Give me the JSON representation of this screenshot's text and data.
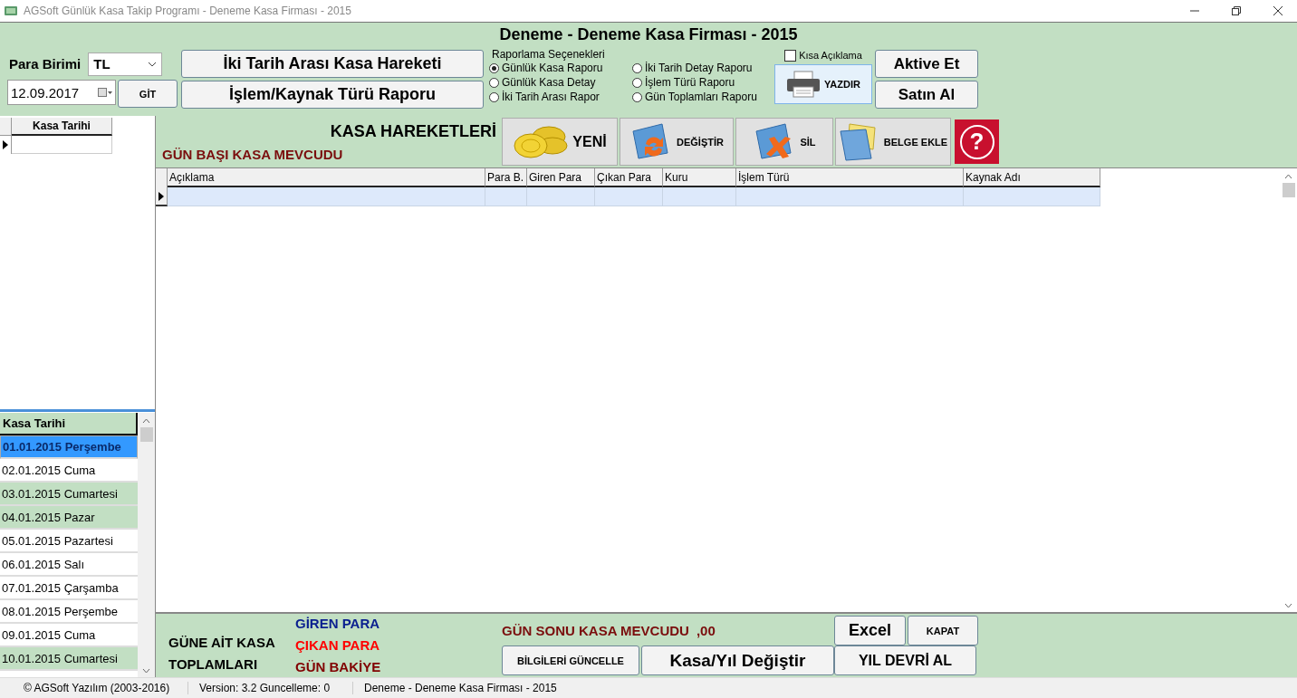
{
  "window": {
    "title": "AGSoft Günlük Kasa Takip Programı - Deneme Kasa Firması - 2015"
  },
  "header": {
    "title": "Deneme - Deneme Kasa Firması - 2015"
  },
  "currency": {
    "label": "Para Birimi",
    "value": "TL"
  },
  "date": {
    "value": "12.09.2017"
  },
  "go_button": "GİT",
  "report_buttons": [
    "İki Tarih Arası Kasa Hareketi",
    "İşlem/Kaynak Türü Raporu"
  ],
  "report_options": {
    "title": "Raporlama Seçenekleri",
    "options": [
      {
        "label": "Günlük Kasa Raporu",
        "selected": true
      },
      {
        "label": "Günlük Kasa Detay",
        "selected": false
      },
      {
        "label": "İki Tarih Arası Rapor",
        "selected": false
      },
      {
        "label": "İki Tarih Detay Raporu",
        "selected": false
      },
      {
        "label": "İşlem Türü Raporu",
        "selected": false
      },
      {
        "label": "Gün Toplamları Raporu",
        "selected": false
      }
    ]
  },
  "short_description": {
    "label": "Kısa Açıklama",
    "checked": false
  },
  "print_button": "YAZDIR",
  "license_buttons": [
    "Aktive Et",
    "Satın Al"
  ],
  "date_grid": {
    "column": "Kasa Tarihi"
  },
  "movements": {
    "title": "KASA HAREKETLERİ",
    "opening_balance": "GÜN BAŞI KASA MEVCUDU"
  },
  "toolbar": [
    {
      "kind": "new",
      "label": "YENİ"
    },
    {
      "kind": "edit",
      "label": "DEĞİŞTİR"
    },
    {
      "kind": "delete",
      "label": "SİL"
    },
    {
      "kind": "attach",
      "label": "BELGE EKLE"
    },
    {
      "kind": "help",
      "label": "?"
    }
  ],
  "table": {
    "columns": [
      "Açıklama",
      "Para B.",
      "Giren Para",
      "Çıkan Para",
      "Kuru",
      "İşlem Türü",
      "Kaynak Adı"
    ]
  },
  "date_list": {
    "title": "Kasa Tarihi",
    "items": [
      {
        "label": "01.01.2015 Perşembe",
        "selected": true,
        "weekend": false
      },
      {
        "label": "02.01.2015 Cuma",
        "selected": false,
        "weekend": false
      },
      {
        "label": "03.01.2015 Cumartesi",
        "selected": false,
        "weekend": true
      },
      {
        "label": "04.01.2015 Pazar",
        "selected": false,
        "weekend": true
      },
      {
        "label": "05.01.2015 Pazartesi",
        "selected": false,
        "weekend": false
      },
      {
        "label": "06.01.2015 Salı",
        "selected": false,
        "weekend": false
      },
      {
        "label": "07.01.2015 Çarşamba",
        "selected": false,
        "weekend": false
      },
      {
        "label": "08.01.2015 Perşembe",
        "selected": false,
        "weekend": false
      },
      {
        "label": "09.01.2015 Cuma",
        "selected": false,
        "weekend": false
      },
      {
        "label": "10.01.2015 Cumartesi",
        "selected": false,
        "weekend": true
      }
    ]
  },
  "totals": {
    "title": "GÜNE AİT KASA TOPLAMLARI",
    "lines": [
      {
        "label": "GİREN PARA",
        "color": "#0a1f8f"
      },
      {
        "label": "ÇIKAN PARA",
        "color": "#ff0000"
      },
      {
        "label": "GÜN BAKİYE",
        "color": "#800000"
      }
    ]
  },
  "closing_balance": {
    "label": "GÜN SONU KASA MEVCUDU",
    "value": ",00"
  },
  "bottom_buttons": {
    "excel": "Excel",
    "close": "KAPAT",
    "update": "BİLGİLERİ GÜNCELLE",
    "switch": "Kasa/Yıl Değiştir",
    "carry_over": "YIL DEVRİ AL"
  },
  "status_bar": [
    "© AGSoft Yazılım (2003-2016)",
    "Version: 3.2 Guncelleme: 0",
    "Deneme - Deneme Kasa Firması - 2015"
  ]
}
